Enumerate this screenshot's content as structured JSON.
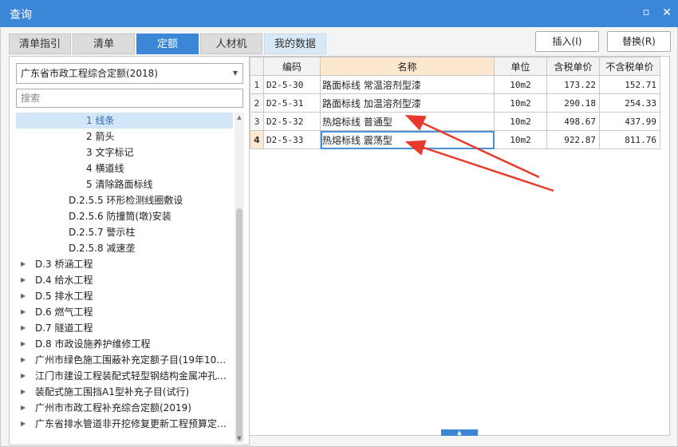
{
  "window": {
    "title": "查询",
    "min_symbol": "▫",
    "close_symbol": "✕"
  },
  "tabs": [
    {
      "label": "清单指引"
    },
    {
      "label": "清单"
    },
    {
      "label": "定额"
    },
    {
      "label": "人材机"
    },
    {
      "label": "我的数据"
    }
  ],
  "actions": {
    "insert_label": "插入(I)",
    "replace_label": "替换(R)"
  },
  "left": {
    "quota_select": "广东省市政工程综合定额(2018)",
    "search_placeholder": "搜索",
    "tree": [
      {
        "label": "1 线条",
        "has_arrow": false,
        "selected": true
      },
      {
        "label": "2 箭头",
        "has_arrow": false
      },
      {
        "label": "3 文字标记",
        "has_arrow": false
      },
      {
        "label": "4 横道线",
        "has_arrow": false
      },
      {
        "label": "5 清除路面标线",
        "has_arrow": false
      },
      {
        "label": "D.2.5.5 环形检测线圈敷设",
        "has_arrow": false
      },
      {
        "label": "D.2.5.6 防撞筒(墩)安装",
        "has_arrow": false
      },
      {
        "label": "D.2.5.7 警示柱",
        "has_arrow": false
      },
      {
        "label": "D.2.5.8 减速垄",
        "has_arrow": false
      },
      {
        "label": "D.3 桥涵工程",
        "has_arrow": true
      },
      {
        "label": "D.4 给水工程",
        "has_arrow": true
      },
      {
        "label": "D.5 排水工程",
        "has_arrow": true
      },
      {
        "label": "D.6 燃气工程",
        "has_arrow": true
      },
      {
        "label": "D.7 隧道工程",
        "has_arrow": true
      },
      {
        "label": "D.8 市政设施养护维修工程",
        "has_arrow": true
      },
      {
        "label": "广州市绿色施工围蔽补充定额子目(19年10…",
        "has_arrow": true
      },
      {
        "label": "江门市建设工程装配式轻型钢结构金属冲孔…",
        "has_arrow": true
      },
      {
        "label": "装配式施工围挡A1型补充子目(试行)",
        "has_arrow": true
      },
      {
        "label": "广州市市政工程补充综合定额(2019)",
        "has_arrow": true
      },
      {
        "label": "广东省排水管道非开挖修复更新工程预算定…",
        "has_arrow": true
      }
    ]
  },
  "grid": {
    "columns": [
      "",
      "编码",
      "名称",
      "单位",
      "含税单价",
      "不含税单价"
    ],
    "rows": [
      {
        "num": "1",
        "code": "D2-5-30",
        "name": "路面标线 常温溶剂型漆",
        "unit": "10m2",
        "price_tax": "173.22",
        "price_notax": "152.71"
      },
      {
        "num": "2",
        "code": "D2-5-31",
        "name": "路面标线 加温溶剂型漆",
        "unit": "10m2",
        "price_tax": "290.18",
        "price_notax": "254.33"
      },
      {
        "num": "3",
        "code": "D2-5-32",
        "name": "热熔标线 普通型",
        "unit": "10m2",
        "price_tax": "498.67",
        "price_notax": "437.99"
      },
      {
        "num": "4",
        "code": "D2-5-33",
        "name": "热熔标线 震荡型",
        "unit": "10m2",
        "price_tax": "922.87",
        "price_notax": "811.76",
        "current": true
      }
    ]
  },
  "colors": {
    "accent": "#3c86d8",
    "annotation": "#e8392b",
    "selection": "#d3e6f8",
    "header_highlight": "#fde7cf"
  }
}
